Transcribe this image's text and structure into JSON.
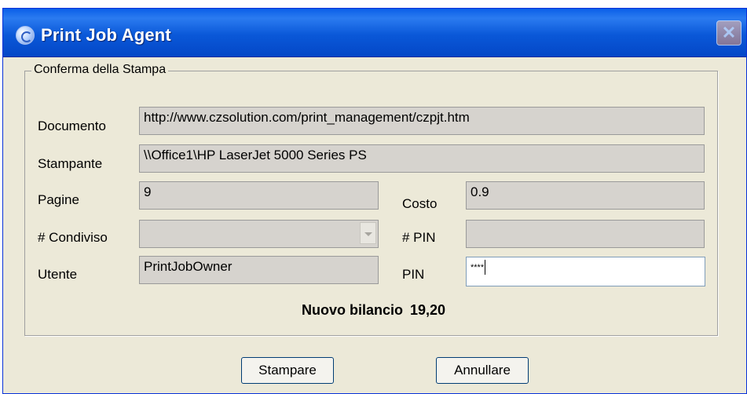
{
  "window": {
    "title": "Print Job Agent"
  },
  "group": {
    "legend": "Conferma della Stampa"
  },
  "fields": {
    "documento": {
      "label": "Documento",
      "value": "http://www.czsolution.com/print_management/czpjt.htm"
    },
    "stampante": {
      "label": "Stampante",
      "value": "\\\\Office1\\HP LaserJet 5000 Series PS"
    },
    "pagine": {
      "label": "Pagine",
      "value": "9"
    },
    "costo": {
      "label": "Costo",
      "value": "0.9"
    },
    "condiviso": {
      "label": "# Condiviso",
      "value": ""
    },
    "pin_num": {
      "label": "# PIN",
      "value": ""
    },
    "utente": {
      "label": "Utente",
      "value": "PrintJobOwner"
    },
    "pin": {
      "label": "PIN",
      "value": "****"
    }
  },
  "balance": {
    "label": "Nuovo bilancio",
    "value": "19,20"
  },
  "buttons": {
    "print": "Stampare",
    "cancel": "Annullare"
  },
  "icons": {
    "app": "print-agent-icon",
    "close": "close-icon"
  }
}
